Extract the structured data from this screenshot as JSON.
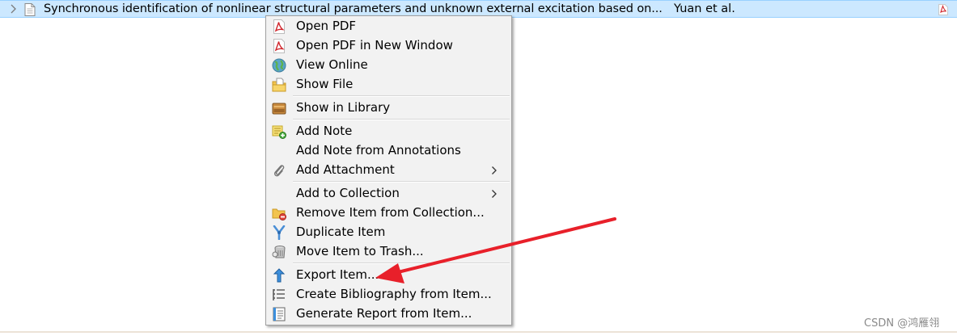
{
  "library_row": {
    "title": "Synchronous identification of nonlinear structural parameters and unknown external excitation based on...",
    "creator": "Yuan et al.",
    "expand_icon": "chevron-right-icon",
    "item_icon": "document-icon",
    "attachment_icon": "pdf-icon",
    "selected_color": "#cce8ff"
  },
  "context_menu": {
    "items": [
      {
        "label": "Open PDF",
        "icon": "pdf-icon"
      },
      {
        "label": "Open PDF in New Window",
        "icon": "pdf-icon"
      },
      {
        "label": "View Online",
        "icon": "globe-icon"
      },
      {
        "label": "Show File",
        "icon": "folder-file-icon"
      },
      {
        "label": "Show in Library",
        "icon": "library-icon"
      },
      {
        "label": "Add Note",
        "icon": "note-add-icon"
      },
      {
        "label": "Add Note from Annotations",
        "icon": ""
      },
      {
        "label": "Add Attachment",
        "icon": "paperclip-icon",
        "submenu": true
      },
      {
        "label": "Add to Collection",
        "icon": "",
        "submenu": true
      },
      {
        "label": "Remove Item from Collection...",
        "icon": "folder-remove-icon"
      },
      {
        "label": "Duplicate Item",
        "icon": "duplicate-icon"
      },
      {
        "label": "Move Item to Trash...",
        "icon": "trash-icon"
      },
      {
        "label": "Export Item...",
        "icon": "export-icon"
      },
      {
        "label": "Create Bibliography from Item...",
        "icon": "bibliography-icon"
      },
      {
        "label": "Generate Report from Item...",
        "icon": "report-icon"
      }
    ]
  },
  "annotation": {
    "color": "#e8202a",
    "points_to": "Export Item..."
  },
  "watermark": "CSDN @鸿雁翎"
}
